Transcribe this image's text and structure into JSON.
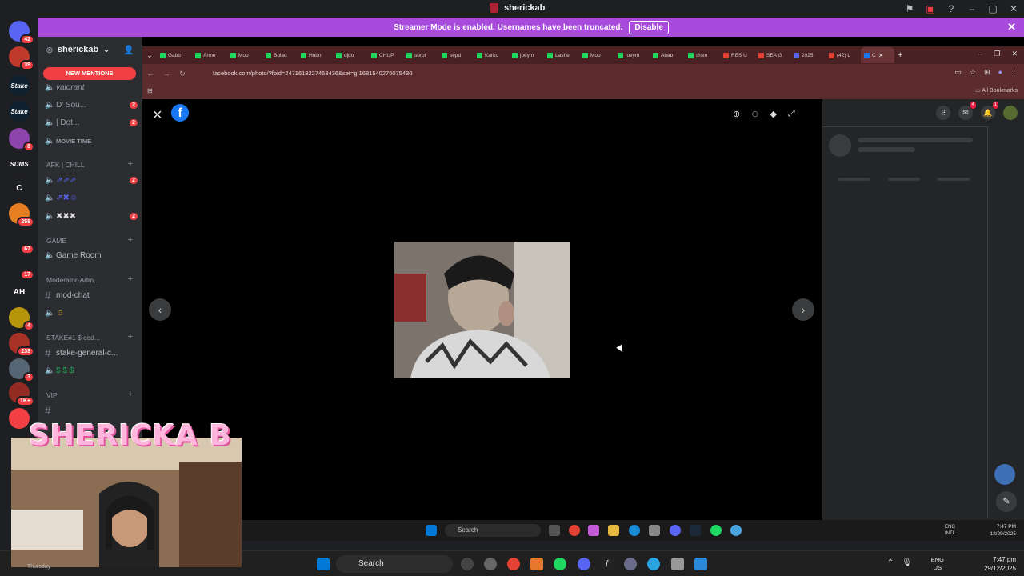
{
  "app": {
    "title": "sherickab"
  },
  "banner": {
    "message": "Streamer Mode is enabled. Usernames have been truncated.",
    "button": "Disable"
  },
  "rail": {
    "servers": [
      {
        "label": "",
        "badge": "42",
        "color": "#5865f2"
      },
      {
        "label": "",
        "badge": "39",
        "color": "#c0392b"
      },
      {
        "label": "Stake",
        "badge": "",
        "color": "#0f212e"
      },
      {
        "label": "Stake",
        "badge": "",
        "color": "#0f212e"
      },
      {
        "label": "",
        "badge": "8",
        "color": "#8e44ad"
      },
      {
        "label": "SDMS",
        "badge": "",
        "color": "#1e1f22"
      },
      {
        "label": "C",
        "badge": "",
        "color": "#1e1f22"
      },
      {
        "label": "",
        "badge": "258",
        "color": "#e67e22"
      },
      {
        "label": "",
        "badge": "67",
        "color": "#1e1f22"
      },
      {
        "label": "",
        "badge": "17",
        "color": "#1e1f22"
      },
      {
        "label": "AH",
        "badge": "",
        "color": "#1e1f22"
      },
      {
        "label": "",
        "badge": "4",
        "color": "#b7950b"
      },
      {
        "label": "",
        "badge": "239",
        "color": "#a93226"
      },
      {
        "label": "",
        "badge": "3",
        "color": "#566573"
      },
      {
        "label": "",
        "badge": "1K+",
        "color": "#922b21"
      },
      {
        "label": "",
        "badge": "",
        "color": "#f23f43"
      }
    ]
  },
  "sidebar": {
    "server_name": "sherickab",
    "new_mentions": "NEW MENTIONS",
    "channels_top": [
      {
        "name": "valorant",
        "count": ""
      },
      {
        "name": "D' Sou...",
        "count": "2"
      },
      {
        "name": "| Dot...",
        "count": "2"
      },
      {
        "name": "MOVIE TIME",
        "count": ""
      }
    ],
    "cat_afk": "AFK | CHILL",
    "afk_channels": [
      {
        "name": "",
        "count": "2"
      },
      {
        "name": "",
        "count": ""
      },
      {
        "name": "",
        "count": "2"
      }
    ],
    "cat_game": "GAME",
    "game_room": "Game Room",
    "cat_mod": "Moderator-Adm...",
    "mod_chat": "mod-chat",
    "cat_stake": "STAKE#1 $ cod...",
    "stake_general": "stake-general-c...",
    "cat_vip": "VIP"
  },
  "browser": {
    "tabs": [
      "Gabb",
      "Arme",
      "Moo",
      "Bulad",
      "Hubn",
      "djdo",
      "CHUP",
      "surot",
      "sepd",
      "Karko",
      "joeym",
      "Lashe",
      "Moo",
      "joeym",
      "Abab",
      "shen",
      "RES U",
      "SEA G",
      "2025",
      "(42) L",
      "C"
    ],
    "url": "facebook.com/photo/?fbid=2471618227463436&set=g.1681540276075430",
    "all_bookmarks": "All Bookmarks"
  },
  "fb": {
    "logo": "f",
    "messenger_badge": "4",
    "notif_badge": "1"
  },
  "inner_taskbar": {
    "search": "Search",
    "lang": "ENG\nINTL",
    "time": "7:47 PM",
    "date": "12/29/2025"
  },
  "outer_taskbar": {
    "search": "Search",
    "lang_top": "ENG",
    "lang_bottom": "US",
    "time": "7:47 pm",
    "date": "29/12/2025"
  },
  "overlay": {
    "title": "SHERICKA B",
    "day": "Thursday"
  }
}
